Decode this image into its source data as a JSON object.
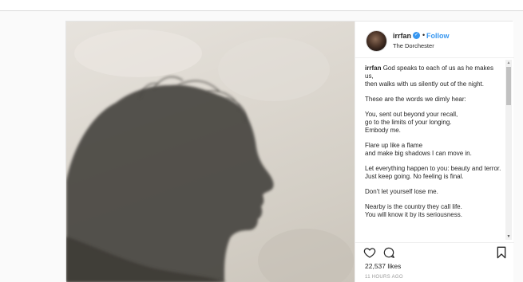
{
  "post": {
    "username": "irrfan",
    "follow_label": "Follow",
    "location": "The Dorchester",
    "caption": [
      "God speaks to each of us as he makes us,\nthen walks with us silently out of the night.",
      "These are the words we dimly hear:",
      "You, sent out beyond your recall,\ngo to the limits of your longing.\nEmbody me.",
      "Flare up like a flame\nand make big shadows I can move in.",
      "Let everything happen to you: beauty and terror.\nJust keep going. No feeling is final.",
      "Don't let yourself lose me.",
      "Nearby is the country they call life.\nYou will know it by its seriousness."
    ],
    "likes": "22,537 likes",
    "timestamp": "11 HOURS AGO"
  },
  "icons": {
    "verified": "verified-badge-icon",
    "like": "heart-icon",
    "comment": "comment-icon",
    "save": "bookmark-icon"
  },
  "colors": {
    "accent": "#3897f0",
    "text": "#262626",
    "muted": "#999999"
  }
}
